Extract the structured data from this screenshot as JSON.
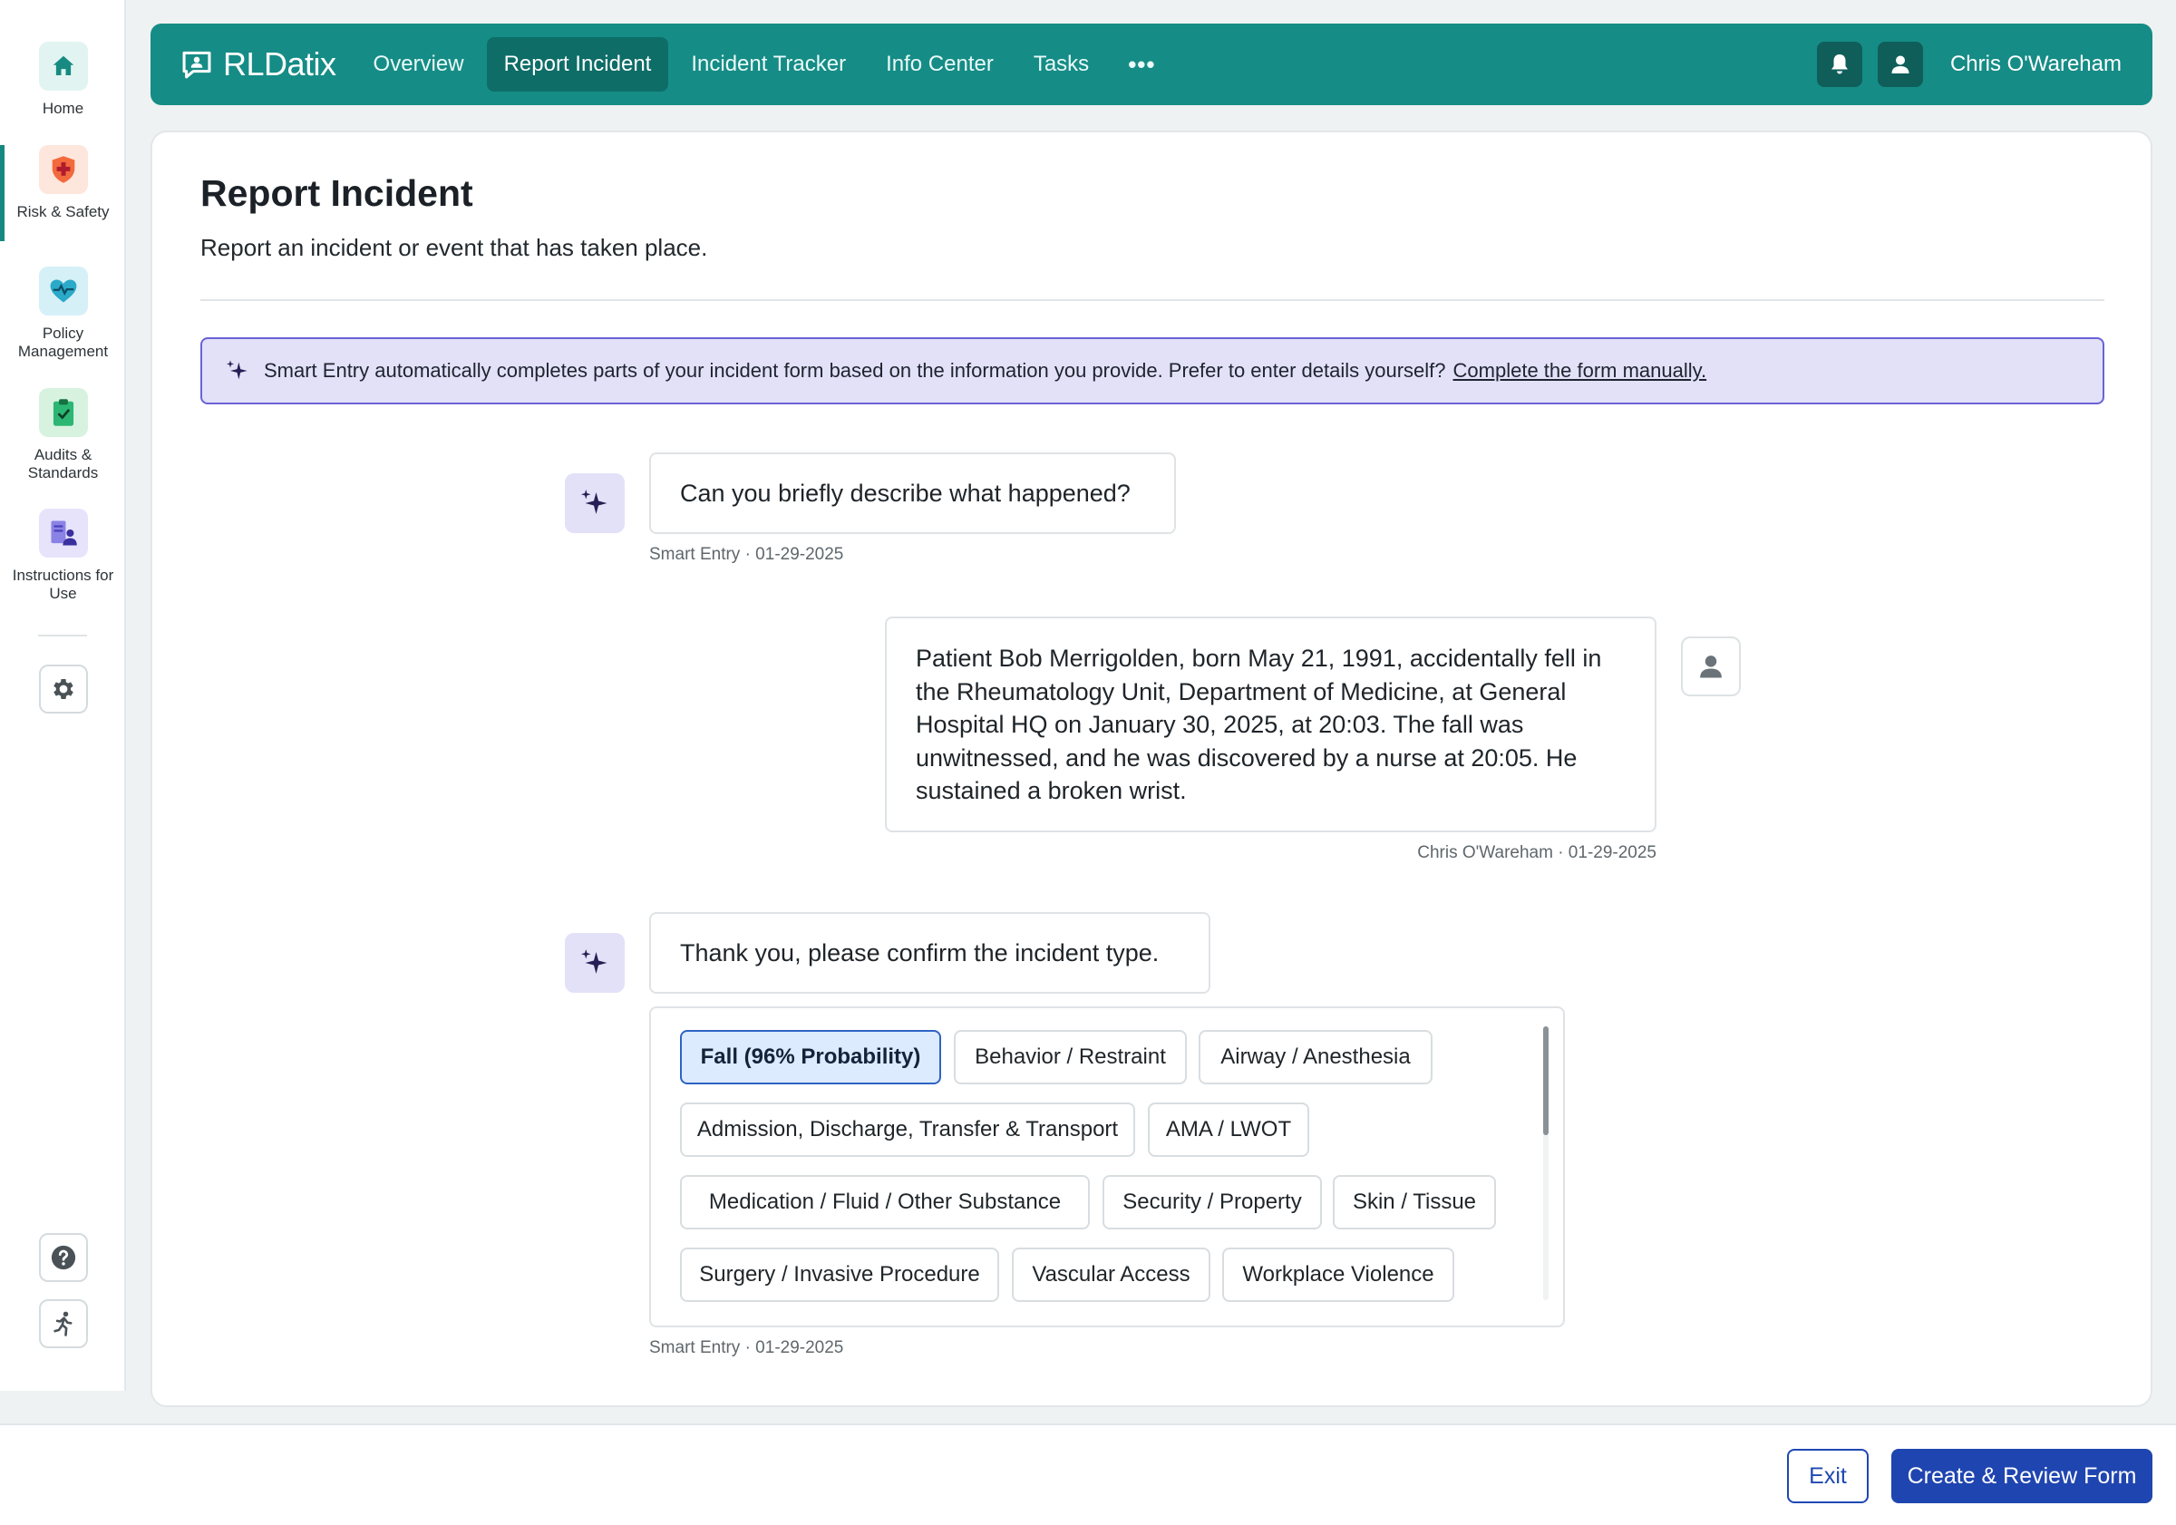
{
  "app": {
    "logo_text": "RLDatix",
    "brand_color": "#168c86",
    "accent_color": "#1f45b0"
  },
  "rail": {
    "items": [
      {
        "label": "Home",
        "icon": "home-icon"
      },
      {
        "label": "Risk & Safety",
        "icon": "shield-plus-icon",
        "active": true
      },
      {
        "label": "Policy Management",
        "icon": "heart-pulse-icon"
      },
      {
        "label": "Audits & Standards",
        "icon": "clipboard-check-icon"
      },
      {
        "label": "Instructions for Use",
        "icon": "document-person-icon"
      }
    ],
    "settings_icon": "gear-icon",
    "help_icon": "help-icon",
    "run_icon": "running-person-icon"
  },
  "nav": {
    "items": [
      "Overview",
      "Report Incident",
      "Incident Tracker",
      "Info Center",
      "Tasks"
    ],
    "active": "Report Incident",
    "more": "•••",
    "user_name": "Chris O'Wareham"
  },
  "page": {
    "title": "Report Incident",
    "subtitle": "Report an incident or event that has taken place."
  },
  "banner": {
    "text": "Smart Entry automatically completes parts of your incident form based on the information you provide. Prefer to enter details yourself?",
    "link": "Complete the form manually."
  },
  "chat": {
    "q1": {
      "text": "Can you briefly describe what happened?",
      "meta": "Smart Entry · 01-29-2025"
    },
    "answer": {
      "text": "Patient Bob Merrigolden, born May 21, 1991, accidentally fell in the Rheumatology Unit, Department of Medicine, at General Hospital HQ on January 30, 2025, at 20:03. The fall was unwitnessed, and he was discovered by a nurse at 20:05. He sustained a broken wrist.",
      "meta": "Chris O'Wareham · 01-29-2025"
    },
    "q2": {
      "text": "Thank you, please confirm the incident type.",
      "meta": "Smart Entry · 01-29-2025"
    },
    "incident_types": [
      "Fall (96% Probability)",
      "Behavior / Restraint",
      "Airway / Anesthesia",
      "Admission, Discharge, Transfer & Transport",
      "AMA / LWOT",
      "Medication / Fluid / Other Substance",
      "Security / Property",
      "Skin / Tissue",
      "Surgery / Invasive Procedure",
      "Vascular Access",
      "Workplace Violence"
    ],
    "selected_type": "Fall (96% Probability)"
  },
  "footer": {
    "exit": "Exit",
    "create": "Create & Review Form"
  }
}
